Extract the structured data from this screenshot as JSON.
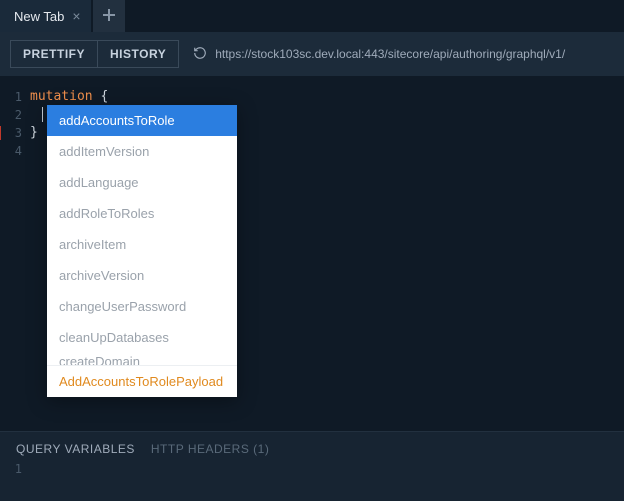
{
  "tabbar": {
    "active_tab_label": "New Tab"
  },
  "toolbar": {
    "prettify_label": "PRETTIFY",
    "history_label": "HISTORY",
    "endpoint_url": "https://stock103sc.dev.local:443/sitecore/api/authoring/graphql/v1/"
  },
  "editor": {
    "line_numbers": [
      "1",
      "2",
      "3",
      "4"
    ],
    "keyword": "mutation",
    "open_brace": "{",
    "close_brace": "}"
  },
  "autocomplete": {
    "items": [
      "addAccountsToRole",
      "addItemVersion",
      "addLanguage",
      "addRoleToRoles",
      "archiveItem",
      "archiveVersion",
      "changeUserPassword",
      "cleanUpDatabases"
    ],
    "cutoff_item": "createDomain",
    "payload_hint": "AddAccountsToRolePayload",
    "selected_index": 0
  },
  "bottom": {
    "query_variables_label": "QUERY VARIABLES",
    "http_headers_label": "HTTP HEADERS (1)",
    "line_number": "1"
  }
}
